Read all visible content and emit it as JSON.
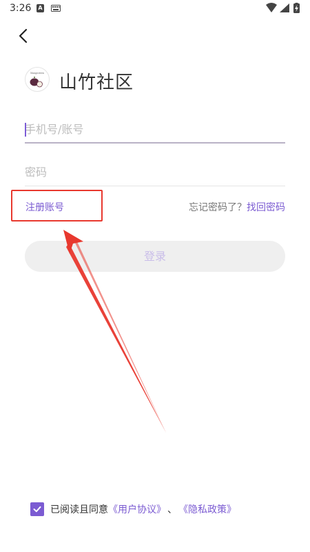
{
  "status_bar": {
    "time": "3:26",
    "notif_letter": "A",
    "icons": [
      "notification-a-icon",
      "keyboard-icon",
      "wifi-icon",
      "signal-icon",
      "battery-charging-icon"
    ]
  },
  "header": {
    "back_icon": "chevron-left-icon"
  },
  "brand": {
    "logo_icon": "mangosteen-logo-icon",
    "title": "山竹社区"
  },
  "form": {
    "phone_placeholder": "手机号/账号",
    "phone_value": "",
    "password_placeholder": "密码",
    "password_value": "",
    "register_label": "注册账号",
    "forgot_label": "忘记密码了？",
    "retrieve_label": "找回密码",
    "login_label": "登录"
  },
  "agreement": {
    "checked": true,
    "prefix": "已阅读且同意",
    "user_agreement": "《用户协议》",
    "separator": "、",
    "privacy_policy": "《隐私政策》"
  },
  "colors": {
    "accent": "#7b5bd2",
    "annotation": "#e8382e",
    "login_disabled_bg": "#efefef",
    "login_disabled_text": "#c9bde9"
  }
}
